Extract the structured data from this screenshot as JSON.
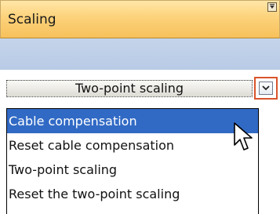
{
  "header": {
    "title": "Scaling"
  },
  "combo": {
    "selected_value": "Two-point scaling"
  },
  "dropdown": {
    "items": [
      {
        "label": "Cable compensation",
        "selected": true
      },
      {
        "label": "Reset cable compensation",
        "selected": false
      },
      {
        "label": "Two-point scaling",
        "selected": false
      },
      {
        "label": "Reset the two-point scaling",
        "selected": false
      }
    ]
  },
  "colors": {
    "header_gradient_top": "#ffe7a8",
    "header_gradient_bottom": "#f7c15c",
    "toolbar_area": "#bfd0e8",
    "selection": "#316ac5",
    "arrow_highlight": "#d9542b"
  },
  "icons": {
    "collapse": "collapse-down-icon",
    "dropdown_arrow": "chevron-down-icon",
    "cursor": "mouse-pointer-icon"
  }
}
